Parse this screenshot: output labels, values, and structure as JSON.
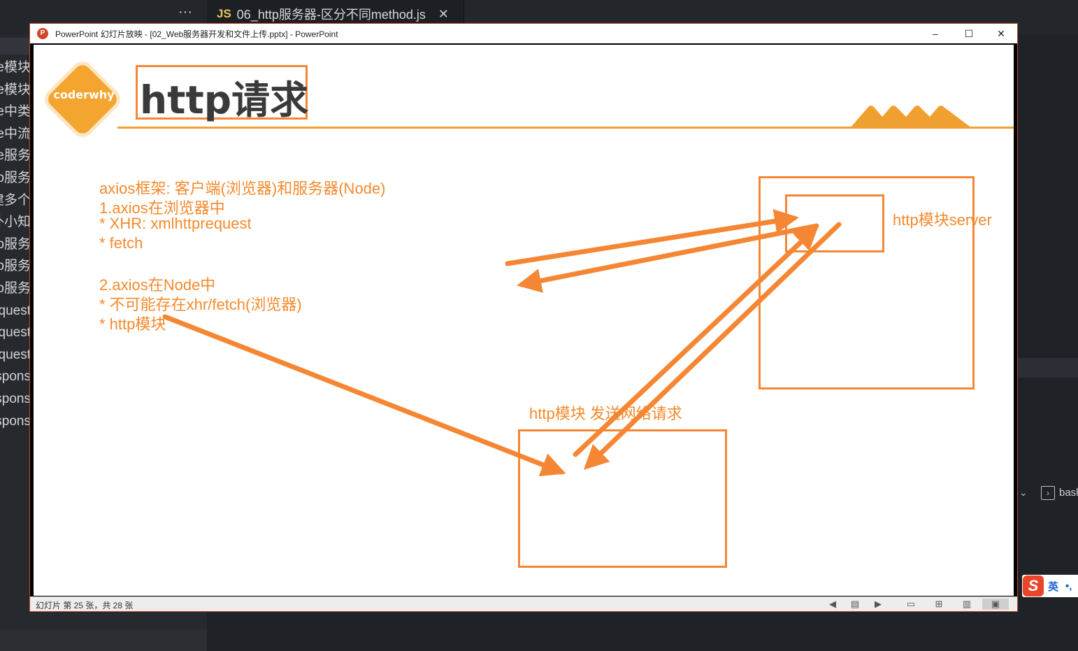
{
  "vscode": {
    "more_label": "···",
    "tab": {
      "lang_badge": "JS",
      "filename": "06_http服务器-区分不同method.js",
      "close_label": "✕"
    },
    "sidebar_files": [
      "de模块",
      "de模块",
      "de中类",
      "de中流",
      "de服务",
      "tp服务",
      "建多个",
      "外小知",
      "tp服务",
      "tp服务",
      "tp服务",
      "quest",
      "quest",
      "quest",
      "spons",
      "spons",
      "spons"
    ],
    "terminal": {
      "chevron": "⌄",
      "icon": "›",
      "label": "bash"
    }
  },
  "ime": {
    "logo": "S",
    "mode": "英",
    "punct": "•,"
  },
  "powerpoint": {
    "window_title": "PowerPoint 幻灯片放映 - [02_Web服务器开发和文件上传.pptx] - PowerPoint",
    "buttons": {
      "minimize": "–",
      "maximize": "☐",
      "close": "✕"
    },
    "status": "幻灯片 第 25 张，共 28 张",
    "accent": "#f58633",
    "slide": {
      "logo": "coderwhy",
      "title": "http请求",
      "notes": [
        "axios框架: 客户端(浏览器)和服务器(Node)",
        "1.axios在浏览器中",
        "* XHR: xmlhttprequest",
        "* fetch",
        "2.axios在Node中",
        "* 不可能存在xhr/fetch(浏览器)",
        "* http模块"
      ],
      "server_label": "http模块server",
      "client_label": "http模块 发送网络请求"
    }
  }
}
